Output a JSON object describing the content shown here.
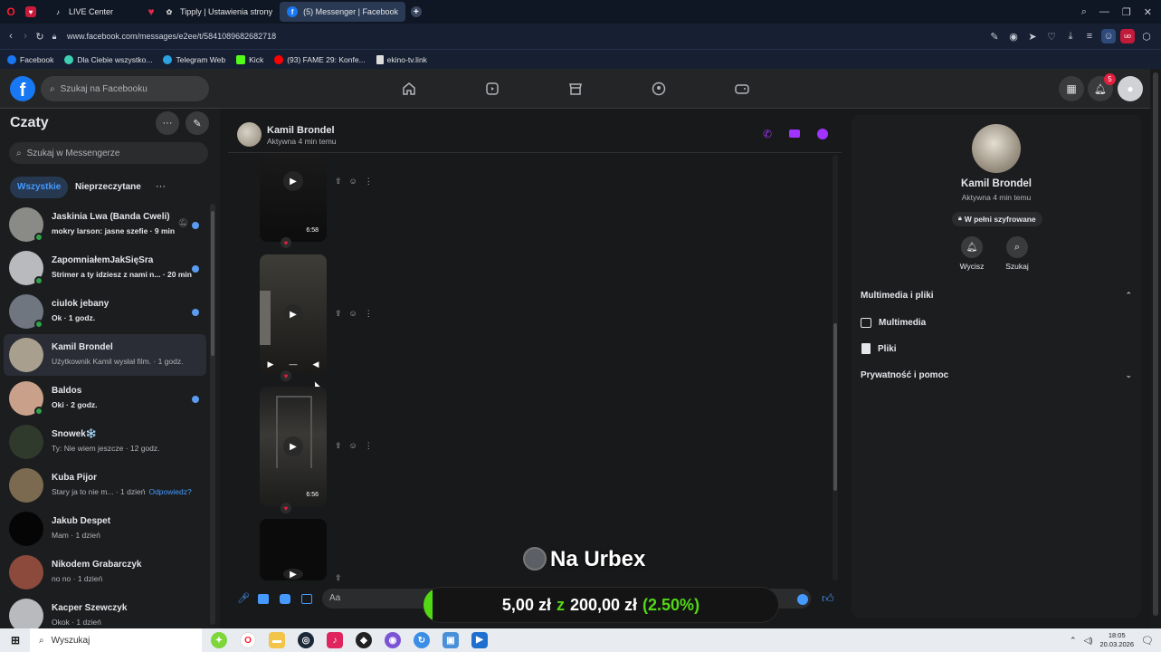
{
  "browser": {
    "tabs": [
      {
        "label": "LIVE Center"
      },
      {
        "label": "Tipply | Ustawienia strony"
      },
      {
        "label": "(5) Messenger | Facebook"
      }
    ],
    "url": "www.facebook.com/messages/e2ee/t/5841089682682718",
    "bookmarks": [
      {
        "label": "Facebook",
        "color": "#1877f2"
      },
      {
        "label": "Dla Ciebie wszystko...",
        "color": "#3ecfb0"
      },
      {
        "label": "Telegram Web",
        "color": "#2aa3e0"
      },
      {
        "label": "Kick",
        "color": "#53fc18"
      },
      {
        "label": "(93) FAME 29: Konfe...",
        "color": "#ff0000"
      },
      {
        "label": "ekino-tv.link",
        "color": "#dddddd"
      }
    ]
  },
  "fb": {
    "search_placeholder": "Szukaj na Facebooku",
    "notification_count": "5"
  },
  "sidebar": {
    "title": "Czaty",
    "search_placeholder": "Szukaj w Messengerze",
    "filters": [
      "Wszystkie",
      "Nieprzeczytane"
    ],
    "more": "···",
    "chats": [
      {
        "name": "Jaskinia Lwa (Banda Cweli)",
        "preview": "mokry larson: jasne szefie · 9 min",
        "unread": true,
        "muted": true,
        "online": true,
        "avatar": "#8a8a86"
      },
      {
        "name": "ZapomniałemJakSięSra",
        "preview": "Strimer a ty idziesz z nami n... · 20 min",
        "unread": true,
        "online": true,
        "avatar": "#b8babd"
      },
      {
        "name": "ciulok jebany",
        "preview": "Ok · 1 godz.",
        "unread": true,
        "online": true,
        "avatar": "#6f7680"
      },
      {
        "name": "Kamil Brondel",
        "preview": "Użytkownik Kamil wysłał film. · 1 godz.",
        "unread": false,
        "online": false,
        "avatar": "#a89f8e",
        "selected": true
      },
      {
        "name": "Baldos",
        "preview": "Oki · 2 godz.",
        "unread": true,
        "online": true,
        "avatar": "#c9a08a"
      },
      {
        "name": "Snowek❄️",
        "preview": "Ty: Nie wiem jeszcze · 12 godz.",
        "unread": false,
        "online": false,
        "avatar": "#2f3a2c"
      },
      {
        "name": "Kuba Pijor",
        "preview": "Stary ja to nie m... · 1 dzień",
        "reply": "Odpowiedz?",
        "unread": false,
        "online": false,
        "avatar": "#7b6a4f"
      },
      {
        "name": "Jakub Despet",
        "preview": "Mam · 1 dzień",
        "unread": false,
        "online": false,
        "avatar": "#050505"
      },
      {
        "name": "Nikodem Grabarczyk",
        "preview": "no no · 1 dzień",
        "unread": false,
        "online": false,
        "avatar": "#8c4a3c"
      },
      {
        "name": "Kacper Szewczyk",
        "preview": "Okok · 1 dzień",
        "unread": false,
        "online": false,
        "avatar": "#b8babd"
      }
    ]
  },
  "conversation": {
    "name": "Kamil Brondel",
    "status": "Aktywna 4 min temu",
    "videos": [
      {
        "duration": "6:58"
      },
      {
        "duration": ""
      },
      {
        "duration": "6:56"
      },
      {
        "duration": ""
      }
    ],
    "input_placeholder": "Aa",
    "accent": "#a033ff"
  },
  "overlay": {
    "goal_text": "Na Urbex",
    "goal_current": "5,00 zł",
    "goal_sep": "z",
    "goal_target": "200,00 zł",
    "goal_percent": "(2.50%)",
    "goal_progress": 0.025
  },
  "right_panel": {
    "name": "Kamil Brondel",
    "status": "Aktywna 4 min temu",
    "encryption": "W pełni szyfrowane",
    "actions": [
      "Wycisz",
      "Szukaj"
    ],
    "sections": [
      {
        "label": "Multimedia i pliki",
        "expanded": true,
        "items": [
          "Multimedia",
          "Pliki"
        ]
      },
      {
        "label": "Prywatność i pomoc",
        "expanded": false,
        "items": []
      }
    ]
  },
  "taskbar": {
    "search_placeholder": "Wyszukaj",
    "time": "18:05",
    "date": "20.03.2026"
  }
}
